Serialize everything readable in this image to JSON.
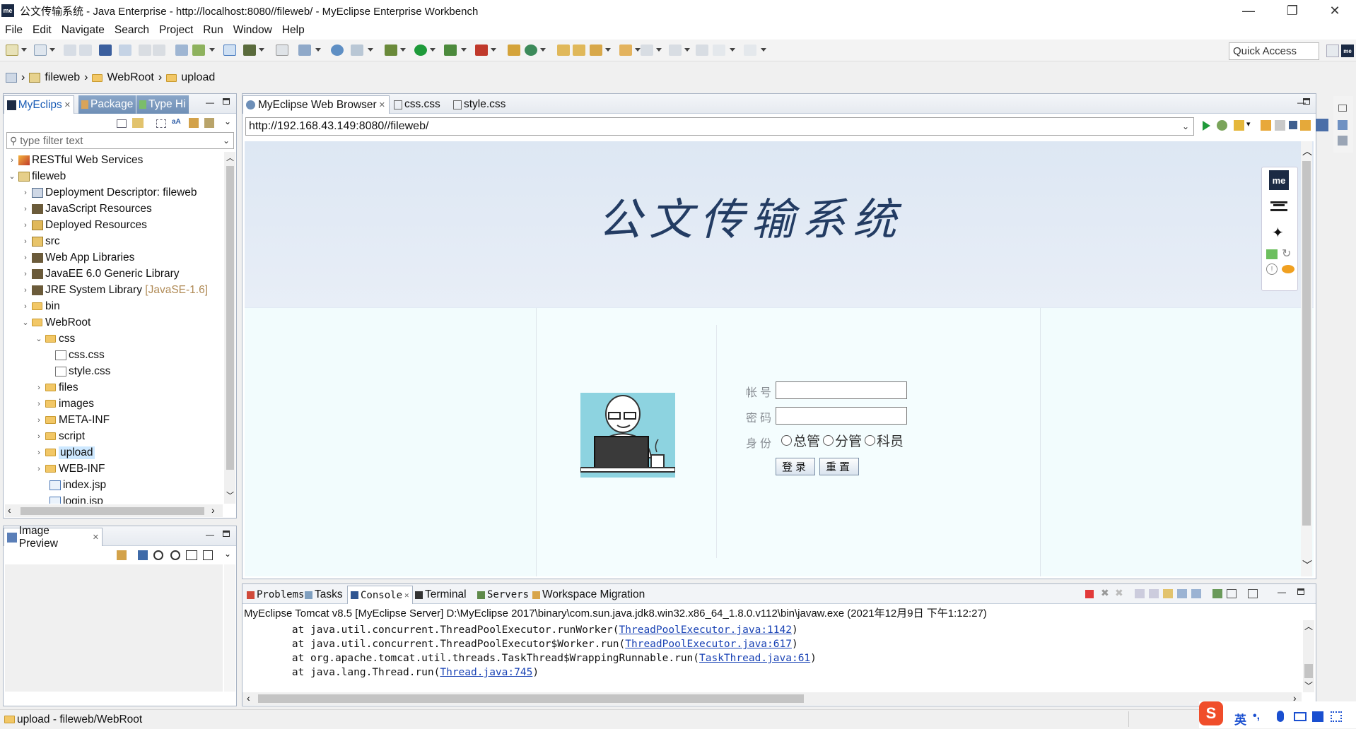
{
  "window": {
    "title": "公文传输系统 - Java Enterprise - http://localhost:8080//fileweb/ - MyEclipse Enterprise Workbench",
    "logo_text": "me",
    "minimize": "—",
    "restore": "❐",
    "close": "✕"
  },
  "menu": [
    "File",
    "Edit",
    "Navigate",
    "Search",
    "Project",
    "Run",
    "Window",
    "Help"
  ],
  "toolbar": {
    "quick_access": "Quick Access"
  },
  "breadcrumb": {
    "items": [
      "fileweb",
      "WebRoot",
      "upload"
    ],
    "sep": "›"
  },
  "explorer": {
    "tabs": [
      {
        "label": "MyEclips",
        "close": "✕"
      },
      {
        "label": "Package",
        "close": ""
      },
      {
        "label": "Type Hi",
        "close": ""
      }
    ],
    "filter_placeholder": "type filter text",
    "tree": [
      {
        "label": "RESTful Web Services",
        "suffix": "",
        "chev": "›"
      },
      {
        "label": "fileweb",
        "suffix": "",
        "chev": "⌄"
      },
      {
        "label": "Deployment Descriptor: fileweb",
        "suffix": "",
        "chev": "›"
      },
      {
        "label": "JavaScript Resources",
        "suffix": "",
        "chev": "›"
      },
      {
        "label": "Deployed Resources",
        "suffix": "",
        "chev": "›"
      },
      {
        "label": "src",
        "suffix": "",
        "chev": "›"
      },
      {
        "label": "Web App Libraries",
        "suffix": "",
        "chev": "›"
      },
      {
        "label": "JavaEE 6.0 Generic Library",
        "suffix": "",
        "chev": "›"
      },
      {
        "label": "JRE System Library",
        "suffix": "[JavaSE-1.6]",
        "chev": "›"
      },
      {
        "label": "bin",
        "suffix": "",
        "chev": "›"
      },
      {
        "label": "WebRoot",
        "suffix": "",
        "chev": "⌄"
      },
      {
        "label": "css",
        "suffix": "",
        "chev": "⌄"
      },
      {
        "label": "css.css",
        "suffix": "",
        "chev": ""
      },
      {
        "label": "style.css",
        "suffix": "",
        "chev": ""
      },
      {
        "label": "files",
        "suffix": "",
        "chev": "›"
      },
      {
        "label": "images",
        "suffix": "",
        "chev": "›"
      },
      {
        "label": "META-INF",
        "suffix": "",
        "chev": "›"
      },
      {
        "label": "script",
        "suffix": "",
        "chev": "›"
      },
      {
        "label": "upload",
        "suffix": "",
        "chev": "›"
      },
      {
        "label": "WEB-INF",
        "suffix": "",
        "chev": "›"
      },
      {
        "label": "index.jsp",
        "suffix": "",
        "chev": ""
      },
      {
        "label": "login.jsp",
        "suffix": "",
        "chev": ""
      }
    ]
  },
  "image_preview": {
    "tab": "Image Preview",
    "close": "✕"
  },
  "editor": {
    "tabs": [
      {
        "label": "MyEclipse Web Browser",
        "close": "✕"
      },
      {
        "label": "css.css",
        "close": ""
      },
      {
        "label": "style.css",
        "close": ""
      }
    ],
    "url": "http://192.168.43.149:8080//fileweb/"
  },
  "webpage": {
    "title": "公文传输系统",
    "account_label": "帐号",
    "password_label": "密码",
    "identity_label": "身份",
    "roles": [
      "总管",
      "分管",
      "科员"
    ],
    "login_button": "登录",
    "reset_button": "重置",
    "side_logo": "me"
  },
  "console": {
    "tabs": [
      "Problems",
      "Tasks",
      "Console",
      "Terminal",
      "Servers",
      "Workspace Migration"
    ],
    "header": "MyEclipse Tomcat v8.5 [MyEclipse Server] D:\\MyEclipse 2017\\binary\\com.sun.java.jdk8.win32.x86_64_1.8.0.v112\\bin\\javaw.exe (2021年12月9日 下午1:12:27)",
    "lines": [
      {
        "prefix": "\tat java.util.concurrent.ThreadPoolExecutor.runWorker(",
        "link": "ThreadPoolExecutor.java:1142",
        "suffix": ")"
      },
      {
        "prefix": "\tat java.util.concurrent.ThreadPoolExecutor$Worker.run(",
        "link": "ThreadPoolExecutor.java:617",
        "suffix": ")"
      },
      {
        "prefix": "\tat org.apache.tomcat.util.threads.TaskThread$WrappingRunnable.run(",
        "link": "TaskThread.java:61",
        "suffix": ")"
      },
      {
        "prefix": "\tat java.lang.Thread.run(",
        "link": "Thread.java:745",
        "suffix": ")"
      }
    ]
  },
  "statusbar": {
    "text": "upload - fileweb/WebRoot"
  },
  "ime": {
    "lang": "英",
    "punct": "•,",
    "logo": "S"
  },
  "colors": {
    "accent": "#1a43b5",
    "selection": "#cde8ff",
    "page_bg": "#f2fcfd",
    "title_ink": "#233c63"
  }
}
